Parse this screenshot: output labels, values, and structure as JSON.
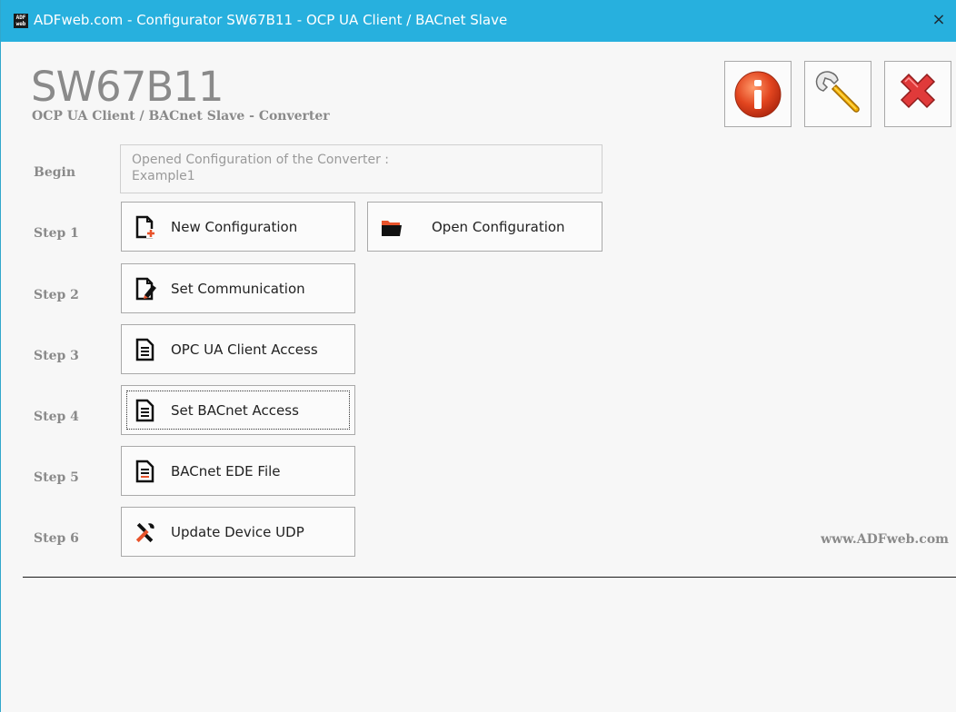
{
  "window": {
    "title": "ADFweb.com - Configurator SW67B11 - OCP UA Client / BACnet Slave",
    "app_icon_text": "ADF web",
    "close_glyph": "×"
  },
  "header": {
    "product_code": "SW67B11",
    "product_subtitle": "OCP UA Client / BACnet Slave - Converter",
    "buttons": [
      {
        "name": "info-icon"
      },
      {
        "name": "wrench-icon"
      },
      {
        "name": "exit-icon"
      }
    ]
  },
  "steps": {
    "begin": {
      "label": "Begin",
      "info_line1": "Opened Configuration of the Converter :",
      "info_line2": "Example1"
    },
    "step1": {
      "label": "Step 1",
      "new_config": "New Configuration",
      "open_config": "Open Configuration"
    },
    "step2": {
      "label": "Step 2",
      "button": "Set Communication"
    },
    "step3": {
      "label": "Step 3",
      "button": "OPC UA Client Access"
    },
    "step4": {
      "label": "Step 4",
      "button": "Set BACnet Access"
    },
    "step5": {
      "label": "Step 5",
      "button": "BACnet EDE File"
    },
    "step6": {
      "label": "Step 6",
      "button": "Update Device UDP"
    }
  },
  "footer": {
    "website": "www.ADFweb.com"
  },
  "colors": {
    "titlebar": "#27b0de",
    "accent_orange": "#e8532b",
    "info_red": "#d8381d",
    "exit_red": "#d62f2f"
  }
}
